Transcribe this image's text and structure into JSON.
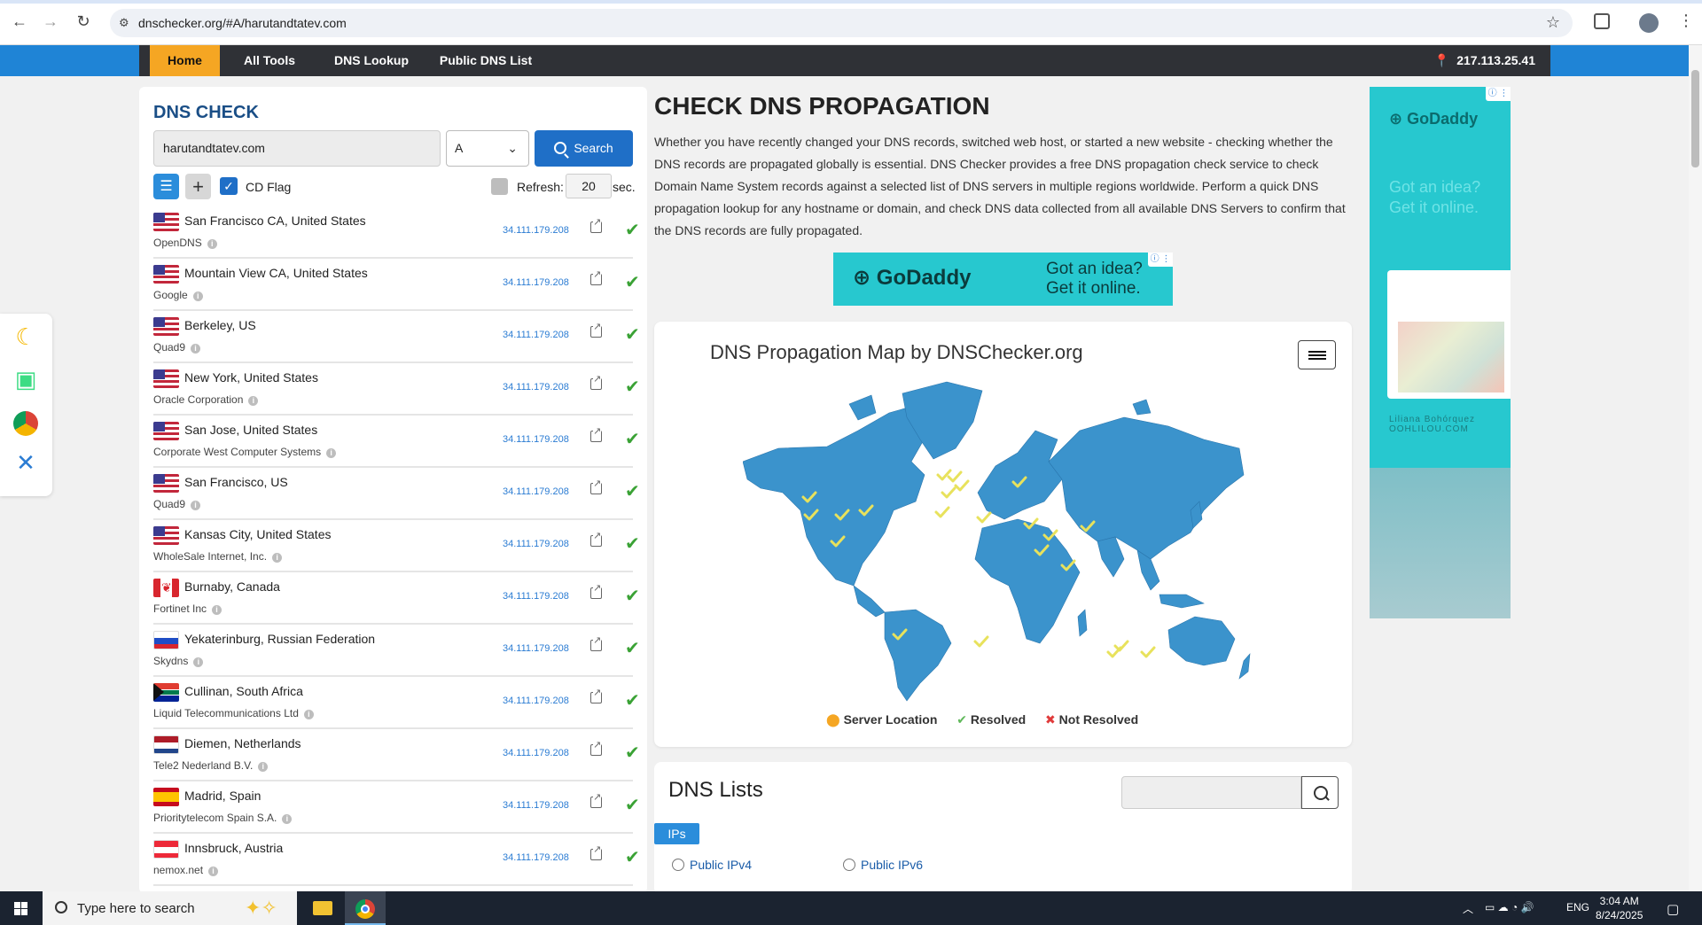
{
  "browser": {
    "url": "dnschecker.org/#A/harutandtatev.com"
  },
  "nav": {
    "items": [
      "Home",
      "All Tools",
      "DNS Lookup",
      "Public DNS List"
    ],
    "ip": "217.113.25.41"
  },
  "dns_check": {
    "title": "DNS CHECK",
    "domain": "harutandtatev.com",
    "record_type": "A",
    "search_label": "Search",
    "cd_flag_label": "CD Flag",
    "refresh_label": "Refresh:",
    "refresh_value": "20",
    "refresh_unit": "sec."
  },
  "results": [
    {
      "location": "San Francisco CA, United States",
      "provider": "OpenDNS",
      "ip": "34.111.179.208",
      "flag": "us"
    },
    {
      "location": "Mountain View CA, United States",
      "provider": "Google",
      "ip": "34.111.179.208",
      "flag": "us"
    },
    {
      "location": "Berkeley, US",
      "provider": "Quad9",
      "ip": "34.111.179.208",
      "flag": "us"
    },
    {
      "location": "New York, United States",
      "provider": "Oracle Corporation",
      "ip": "34.111.179.208",
      "flag": "us"
    },
    {
      "location": "San Jose, United States",
      "provider": "Corporate West Computer Systems",
      "ip": "34.111.179.208",
      "flag": "us"
    },
    {
      "location": "San Francisco, US",
      "provider": "Quad9",
      "ip": "34.111.179.208",
      "flag": "us"
    },
    {
      "location": "Kansas City, United States",
      "provider": "WholeSale Internet, Inc.",
      "ip": "34.111.179.208",
      "flag": "us"
    },
    {
      "location": "Burnaby, Canada",
      "provider": "Fortinet Inc",
      "ip": "34.111.179.208",
      "flag": "ca"
    },
    {
      "location": "Yekaterinburg, Russian Federation",
      "provider": "Skydns",
      "ip": "34.111.179.208",
      "flag": "ru"
    },
    {
      "location": "Cullinan, South Africa",
      "provider": "Liquid Telecommunications Ltd",
      "ip": "34.111.179.208",
      "flag": "za"
    },
    {
      "location": "Diemen, Netherlands",
      "provider": "Tele2 Nederland B.V.",
      "ip": "34.111.179.208",
      "flag": "nl"
    },
    {
      "location": "Madrid, Spain",
      "provider": "Prioritytelecom Spain S.A.",
      "ip": "34.111.179.208",
      "flag": "es"
    },
    {
      "location": "Innsbruck, Austria",
      "provider": "nemox.net",
      "ip": "34.111.179.208",
      "flag": "at"
    }
  ],
  "main": {
    "title": "CHECK DNS PROPAGATION",
    "intro": "Whether you have recently changed your DNS records, switched web host, or started a new website - checking whether the DNS records are propagated globally is essential. DNS Checker provides a free DNS propagation check service to check Domain Name System records against a selected list of DNS servers in multiple regions worldwide. Perform a quick DNS propagation lookup for any hostname or domain, and check DNS data collected from all available DNS Servers to confirm that the DNS records are fully propagated."
  },
  "banner_ad": {
    "brand": "GoDaddy",
    "tagline": "Got an idea? Get it online."
  },
  "map": {
    "title": "DNS Propagation Map by DNSChecker.org",
    "legend": [
      "Server Location",
      "Resolved",
      "Not Resolved"
    ]
  },
  "dns_lists": {
    "title": "DNS Lists",
    "tab": "IPs",
    "links": [
      "Public IPv4",
      "Public IPv6"
    ]
  },
  "side_ad": {
    "brand": "GoDaddy",
    "tagline": "Got an idea? Get it online.",
    "caption_name": "Liliana Bohórquez",
    "caption_site": "OOHLILOU.COM"
  },
  "taskbar": {
    "search_placeholder": "Type here to search",
    "lang": "ENG",
    "time": "3:04 AM",
    "date": "8/24/2025"
  },
  "colors": {
    "brand_blue": "#1f84d6",
    "home_tab": "#f5a623",
    "resolved": "#3aa235",
    "ad_teal": "#27c8cf"
  }
}
